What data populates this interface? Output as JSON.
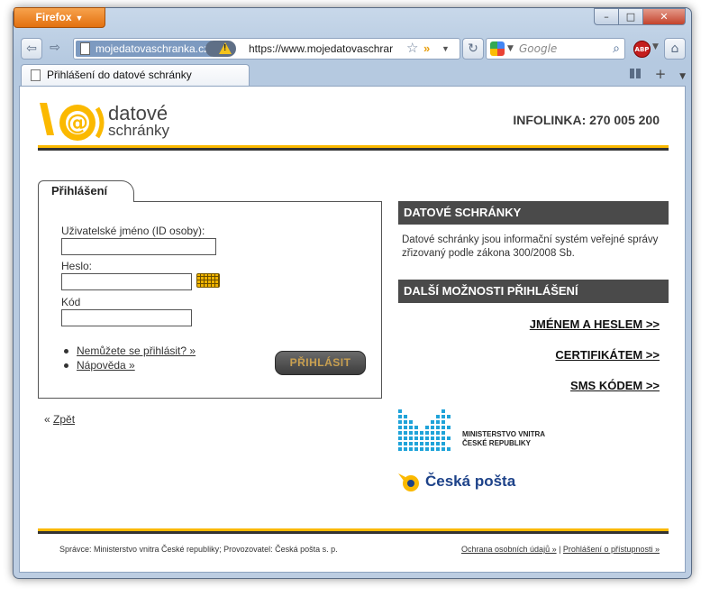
{
  "browser": {
    "menu_button": "Firefox",
    "window_controls": {
      "minimize": "–",
      "maximize": "□",
      "close": "✕"
    },
    "identity_label": "mojedatovaschranka.cz",
    "url": "https://www.mojedatovaschrar",
    "search_placeholder": "Google",
    "tab_title": "Přihlášení do datové schránky",
    "abp_label": "ABP"
  },
  "header": {
    "logo_line1": "datové",
    "logo_line2": "schránky",
    "infolinka": "INFOLINKA: 270 005 200"
  },
  "login": {
    "tab_label": "Přihlášení",
    "username_label": "Uživatelské jméno (ID osoby):",
    "password_label": "Heslo:",
    "code_label": "Kód",
    "link_cannot_login": "Nemůžete se přihlásit? »",
    "link_help": "Nápověda »",
    "submit_label": "PŘIHLÁSIT",
    "back_prefix": "« ",
    "back_link": "Zpět"
  },
  "sidebar": {
    "section1_title": "DATOVÉ SCHRÁNKY",
    "section1_text": "Datové schránky jsou informační systém veřejné správy zřizovaný podle zákona 300/2008 Sb.",
    "section2_title": "DALŠÍ MOŽNOSTI PŘIHLÁŠENÍ",
    "options": [
      {
        "label": "JMÉNEM A HESLEM  >>"
      },
      {
        "label": "CERTIFIKÁTEM  >>"
      },
      {
        "label": "SMS KÓDEM  >>"
      }
    ],
    "ministry_line1": "MINISTERSTVO VNITRA",
    "ministry_line2": "ČESKÉ REPUBLIKY",
    "post_name": "Česká pošta"
  },
  "footer": {
    "left_text": "Správce: Ministerstvo vnitra České republiky; Provozovatel: Česká pošta s. p.",
    "privacy_link": "Ochrana osobních údajů »",
    "separator": " | ",
    "accessibility_link": "Prohlášení o přístupnosti »"
  },
  "colors": {
    "brand_yellow": "#fbb900",
    "bar_dark": "#4a4a4a",
    "post_blue": "#1d4289",
    "ministry_cyan": "#1fa3d9"
  }
}
